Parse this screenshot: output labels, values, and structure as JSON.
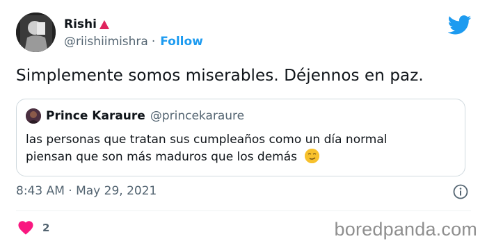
{
  "author": {
    "name": "Rishi",
    "handle": "@riishiimishra",
    "separator": "·",
    "follow_label": "Follow"
  },
  "tweet": {
    "text": "Simplemente somos miserables. Déjennos en paz."
  },
  "quoted_tweet": {
    "name": "Prince Karaure",
    "handle": "@princekaraure",
    "line1": "las personas que tratan sus cumpleaños como un día normal",
    "line2": "piensan que son más maduros que los demás"
  },
  "meta": {
    "timestamp": "8:43 AM · May 29, 2021",
    "like_count": "2"
  },
  "watermark": "boredpanda.com",
  "colors": {
    "accent": "#1d9bf0",
    "like": "#f91880",
    "text": "#0f1419",
    "secondary": "#536471",
    "border": "#cfd9de"
  },
  "icons": [
    "twitter-bird-icon",
    "warning-triangle-icon",
    "info-icon",
    "heart-icon",
    "smirk-emoji-icon"
  ]
}
